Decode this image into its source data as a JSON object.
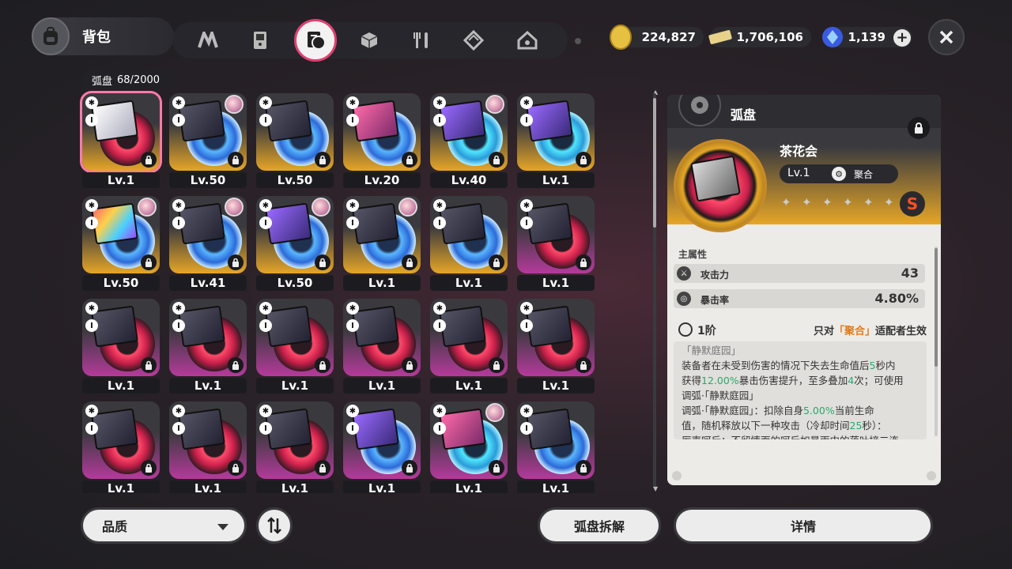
{
  "header": {
    "title": "背包",
    "tabs": [
      {
        "icon": "logo-n-icon"
      },
      {
        "icon": "device-icon"
      },
      {
        "icon": "disc-icon"
      },
      {
        "icon": "cube-icon"
      },
      {
        "icon": "food-icon"
      },
      {
        "icon": "crystal-icon"
      },
      {
        "icon": "house-icon"
      }
    ],
    "currencies": [
      {
        "icon": "gold-coin-icon",
        "value": "224,827"
      },
      {
        "icon": "ticket-icon",
        "value": "1,706,106"
      },
      {
        "icon": "crystal-icon",
        "value": "1,139"
      }
    ]
  },
  "inventory": {
    "label": "弧盘",
    "count": "68/2000",
    "items": [
      {
        "rarity": "gold",
        "ring": "red",
        "cover": "white",
        "avatar": false,
        "level": "Lv.1",
        "selected": true
      },
      {
        "rarity": "gold",
        "ring": "blue",
        "cover": "default",
        "avatar": true,
        "level": "Lv.50"
      },
      {
        "rarity": "gold",
        "ring": "blue",
        "cover": "default",
        "avatar": false,
        "level": "Lv.50"
      },
      {
        "rarity": "gold",
        "ring": "blue",
        "cover": "pink",
        "avatar": false,
        "level": "Lv.20"
      },
      {
        "rarity": "gold",
        "ring": "cyan",
        "cover": "purp",
        "avatar": true,
        "level": "Lv.40"
      },
      {
        "rarity": "gold",
        "ring": "cyan",
        "cover": "purp",
        "avatar": false,
        "level": "Lv.1"
      },
      {
        "rarity": "gold",
        "ring": "blue",
        "cover": "rainbow",
        "avatar": true,
        "level": "Lv.50"
      },
      {
        "rarity": "gold",
        "ring": "blue",
        "cover": "default",
        "avatar": true,
        "level": "Lv.41"
      },
      {
        "rarity": "gold",
        "ring": "blue",
        "cover": "purp",
        "avatar": true,
        "level": "Lv.50"
      },
      {
        "rarity": "gold",
        "ring": "blue",
        "cover": "default",
        "avatar": true,
        "level": "Lv.1"
      },
      {
        "rarity": "gold",
        "ring": "blue",
        "cover": "default",
        "avatar": false,
        "level": "Lv.1"
      },
      {
        "rarity": "purple",
        "ring": "red",
        "cover": "default",
        "avatar": false,
        "level": "Lv.1"
      },
      {
        "rarity": "purple",
        "ring": "red",
        "cover": "default",
        "avatar": false,
        "level": "Lv.1"
      },
      {
        "rarity": "purple",
        "ring": "red",
        "cover": "default",
        "avatar": false,
        "level": "Lv.1"
      },
      {
        "rarity": "purple",
        "ring": "red",
        "cover": "default",
        "avatar": false,
        "level": "Lv.1"
      },
      {
        "rarity": "purple",
        "ring": "red",
        "cover": "default",
        "avatar": false,
        "level": "Lv.1"
      },
      {
        "rarity": "purple",
        "ring": "red",
        "cover": "default",
        "avatar": false,
        "level": "Lv.1"
      },
      {
        "rarity": "purple",
        "ring": "red",
        "cover": "default",
        "avatar": false,
        "level": "Lv.1"
      },
      {
        "rarity": "purple",
        "ring": "red",
        "cover": "default",
        "avatar": false,
        "level": "Lv.1"
      },
      {
        "rarity": "purple",
        "ring": "red",
        "cover": "default",
        "avatar": false,
        "level": "Lv.1"
      },
      {
        "rarity": "purple",
        "ring": "red",
        "cover": "default",
        "avatar": false,
        "level": "Lv.1"
      },
      {
        "rarity": "purple",
        "ring": "blue",
        "cover": "purp",
        "avatar": false,
        "level": "Lv.1"
      },
      {
        "rarity": "purple",
        "ring": "cyan",
        "cover": "pink",
        "avatar": true,
        "level": "Lv.1"
      },
      {
        "rarity": "purple",
        "ring": "blue",
        "cover": "default",
        "avatar": false,
        "level": "Lv.1"
      }
    ]
  },
  "detail": {
    "category": "弧盘",
    "name": "茶花会",
    "level": "Lv.1",
    "class_label": "聚合",
    "rank": "S",
    "stars": [
      "✦",
      "✦",
      "✦",
      "✦",
      "✦",
      "✦"
    ],
    "main_attr_label": "主属性",
    "stats": [
      {
        "icon": "attack-icon",
        "name": "攻击力",
        "value": "43"
      },
      {
        "icon": "crit-icon",
        "name": "暴击率",
        "value": "4.80%"
      }
    ],
    "effect": {
      "tier": "1阶",
      "cond_prefix": "只对",
      "cond_highlight": "「聚合」",
      "cond_suffix": "适配者生效",
      "title": "「静默庭园」",
      "l1a": "装备者在未受到伤害的情况下失去生命值后",
      "l1b": "5",
      "l1c": "秒内",
      "l2a": "获得",
      "l2b": "12.00%",
      "l2c": "暴击伤害提升，至多叠加",
      "l2d": "4",
      "l2e": "次；可使用",
      "l3": "调弧·「静默庭园」",
      "l4a": "调弧·「静默庭园」：扣除自身",
      "l4b": "5.00%",
      "l4c": "当前生命",
      "l5a": "值，随机释放以下一种攻击（冷却时间",
      "l5b": "25",
      "l5c": "秒）：",
      "l6": "厉声呵斥：不留情面的呵斥如暴雨中的落叶接二连"
    }
  },
  "footer": {
    "quality_label": "品质",
    "dismantle_label": "弧盘拆解",
    "details_label": "详情"
  }
}
